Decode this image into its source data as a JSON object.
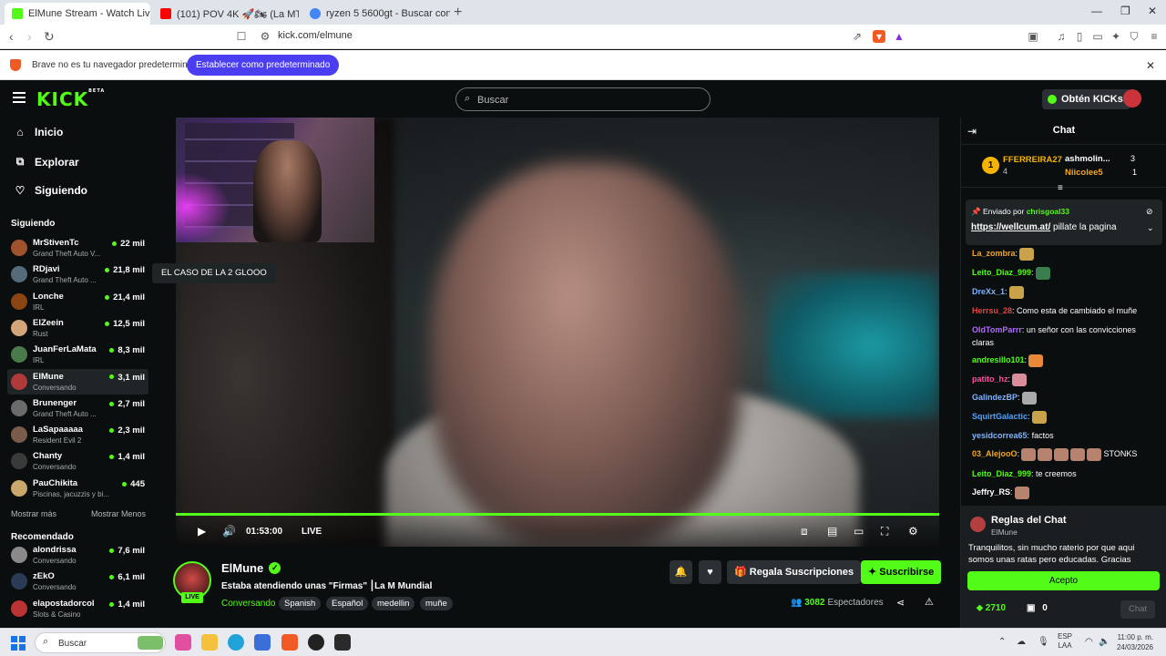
{
  "browser": {
    "tabs": [
      {
        "title": "ElMune Stream - Watch Live on",
        "active": true,
        "favicon_color": "#53fc18"
      },
      {
        "title": "(101) POV 4K 🚀🏍 (La MT-09 c...",
        "active": false,
        "favicon_color": "#ff0000"
      },
      {
        "title": "ryzen 5 5600gt - Buscar con Google",
        "active": false,
        "favicon_color": "#4285f4"
      }
    ],
    "url": "kick.com/elmune",
    "infobar_text": "Brave no es tu navegador predeterminado",
    "infobar_button": "Establecer como predeterminado"
  },
  "kick": {
    "logo": "KICK",
    "logo_beta": "BETA",
    "search_placeholder": "Buscar",
    "kicks_button": "Obtén KICKs",
    "accent": "#53fc18"
  },
  "sidebar": {
    "nav": [
      {
        "label": "Inicio",
        "icon": "home-icon"
      },
      {
        "label": "Explorar",
        "icon": "compass-icon"
      },
      {
        "label": "Siguiendo",
        "icon": "heart-icon"
      }
    ],
    "following_heading": "Siguiendo",
    "following": [
      {
        "name": "MrStivenTc",
        "game": "Grand Theft Auto V...",
        "viewers": "22 mil",
        "color": "#a0522d"
      },
      {
        "name": "RDjavi",
        "game": "Grand Theft Auto ...",
        "viewers": "21,8 mil",
        "color": "#556b7a"
      },
      {
        "name": "Lonche",
        "game": "IRL",
        "viewers": "21,4 mil",
        "color": "#8b4513"
      },
      {
        "name": "ElZeein",
        "game": "Rust",
        "viewers": "12,5 mil",
        "color": "#d2a679"
      },
      {
        "name": "JuanFerLaMata",
        "game": "IRL",
        "viewers": "8,3 mil",
        "color": "#4a7a4a"
      },
      {
        "name": "ElMune",
        "game": "Conversando",
        "viewers": "3,1 mil",
        "color": "#b03a3a",
        "active": true
      },
      {
        "name": "Brunenger",
        "game": "Grand Theft Auto ...",
        "viewers": "2,7 mil",
        "color": "#6b6b6b"
      },
      {
        "name": "LaSapaaaaa",
        "game": "Resident Evil 2",
        "viewers": "2,3 mil",
        "color": "#7a5a4a"
      },
      {
        "name": "Chanty",
        "game": "Conversando",
        "viewers": "1,4 mil",
        "color": "#3a3a3a"
      },
      {
        "name": "PauChikita",
        "game": "Piscinas, jacuzzis y bi...",
        "viewers": "445",
        "color": "#c9a86a"
      }
    ],
    "show_more": "Mostrar más",
    "show_less": "Mostrar Menos",
    "recommended_heading": "Recomendado",
    "recommended": [
      {
        "name": "alondrissa",
        "game": "Conversando",
        "viewers": "7,6 mil",
        "color": "#8a8a8a"
      },
      {
        "name": "zEkO",
        "game": "Conversando",
        "viewers": "6,1 mil",
        "color": "#2b3a55"
      },
      {
        "name": "elapostadorcol",
        "game": "Slots & Casino",
        "viewers": "1,4 mil",
        "color": "#b33"
      }
    ]
  },
  "player": {
    "tooltip": "EL CASO DE LA 2 GLOOO",
    "time": "01:53:00",
    "live_label": "LIVE"
  },
  "stream": {
    "name": "ElMune",
    "live_badge": "LIVE",
    "title": "Estaba atendiendo unas \"Firmas\" ⎮La M Mundial",
    "category": "Conversando",
    "tags": [
      "Spanish",
      "Español",
      "medellin",
      "muñe"
    ],
    "gift_button": "Regala Suscripciones",
    "subscribe_button": "Suscribirse",
    "viewers_count": "3082",
    "viewers_label": "Espectadores"
  },
  "chat": {
    "title": "Chat",
    "leaderboard": [
      {
        "name": "FFERREIRA27",
        "count": "4",
        "rank": "1"
      },
      {
        "name": "ashmolin...",
        "count": "3"
      },
      {
        "name": "Niicolee5",
        "count": "1"
      }
    ],
    "pinned": {
      "prefix": "Enviado por",
      "by": "chrisgoal33",
      "link": "https://wellcum.at/",
      "text": " pillate la pagina"
    },
    "messages": [
      {
        "user": "La_zombra",
        "color": "#f5a623",
        "text": "",
        "emotes": [
          "#c9a34a"
        ]
      },
      {
        "user": "Leito_Diaz_999",
        "color": "#53fc18",
        "text": "",
        "emotes": [
          "#3a7d4e"
        ]
      },
      {
        "user": "DreXx_1",
        "color": "#7fb3ff",
        "text": "",
        "emotes": [
          "#c9a34a"
        ]
      },
      {
        "user": "Herrsu_28",
        "color": "#e04646",
        "text": " Como esta de cambiado el muñe",
        "emotes": []
      },
      {
        "user": "OldTomParrr",
        "color": "#b36bff",
        "text": " un señor con las convicciones claras",
        "emotes": []
      },
      {
        "user": "andresillo101",
        "color": "#53fc18",
        "text": "",
        "emotes": [
          "#e8893a"
        ]
      },
      {
        "user": "patito_hz",
        "color": "#ff4fa1",
        "text": "",
        "emotes": [
          "#d98c9a"
        ]
      },
      {
        "user": "GalindezBP",
        "color": "#7fb3ff",
        "text": "",
        "emotes": [
          "#aaaaaa"
        ]
      },
      {
        "user": "SquirtGalactic",
        "color": "#4fa3ff",
        "text": "",
        "emotes": [
          "#c9a34a"
        ]
      },
      {
        "user": "yesidcorrea65",
        "color": "#7fb3ff",
        "text": " factos",
        "emotes": []
      },
      {
        "user": "03_AlejooO",
        "color": "#f5a623",
        "text": " STONKS",
        "emotes": [
          "#b5836e",
          "#b5836e",
          "#b5836e",
          "#b5836e",
          "#b5836e"
        ]
      },
      {
        "user": "Leito_Diaz_999",
        "color": "#53fc18",
        "text": " te creemos",
        "emotes": []
      },
      {
        "user": "Jeffry_RS",
        "color": "#ffffff",
        "text": "",
        "emotes": [
          "#b5836e"
        ]
      }
    ],
    "rules": {
      "title": "Reglas del Chat",
      "channel": "ElMune",
      "body": "Tranquilitos, sin mucho raterio por que aqui somos unas ratas pero educadas. Gracias",
      "accept": "Acepto"
    },
    "points": "2710",
    "drops": "0",
    "send_button": "Chat"
  },
  "taskbar": {
    "search_placeholder": "Buscar",
    "lang_line1": "ESP",
    "lang_line2": "LAA",
    "time": "11:00 p. m.",
    "date": "24/03/2026"
  }
}
